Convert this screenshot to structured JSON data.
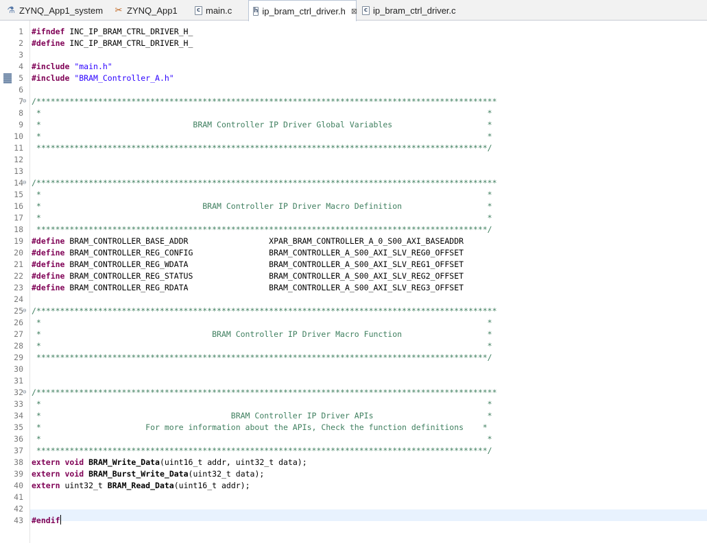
{
  "tabs": [
    {
      "label": "ZYNQ_App1_system",
      "icon": "system-project-icon",
      "glyph": "⚗",
      "active": false
    },
    {
      "label": "ZYNQ_App1",
      "icon": "application-project-icon",
      "glyph": "✂",
      "active": false
    },
    {
      "label": "main.c",
      "icon": "c-source-file-icon",
      "glyph": "c",
      "active": false
    },
    {
      "label": "ip_bram_ctrl_driver.h",
      "icon": "header-file-icon",
      "glyph": "h",
      "active": true
    },
    {
      "label": "ip_bram_ctrl_driver.c",
      "icon": "c-source-file-icon",
      "glyph": "c",
      "active": false
    }
  ],
  "close_glyph": "⊠",
  "fold_glyph": "⊖",
  "colors": {
    "keyword": "#7f0055",
    "string": "#2a00ff",
    "comment": "#3f7f5f",
    "current_line": "#e8f2fe"
  },
  "current_line": 43,
  "lines": [
    {
      "n": "1",
      "seg": [
        {
          "c": "kw",
          "t": "#ifndef"
        },
        {
          "c": "",
          "t": " INC_IP_BRAM_CTRL_DRIVER_H_"
        }
      ]
    },
    {
      "n": "2",
      "seg": [
        {
          "c": "kw",
          "t": "#define"
        },
        {
          "c": "",
          "t": " INC_IP_BRAM_CTRL_DRIVER_H_"
        }
      ]
    },
    {
      "n": "3",
      "seg": []
    },
    {
      "n": "4",
      "seg": [
        {
          "c": "kw",
          "t": "#include"
        },
        {
          "c": "",
          "t": " "
        },
        {
          "c": "str",
          "t": "\"main.h\""
        }
      ]
    },
    {
      "n": "5",
      "marker": true,
      "seg": [
        {
          "c": "kw",
          "t": "#include"
        },
        {
          "c": "",
          "t": " "
        },
        {
          "c": "str",
          "t": "\"BRAM_Controller_A.h\""
        }
      ]
    },
    {
      "n": "6",
      "seg": []
    },
    {
      "n": "7",
      "fold": true,
      "seg": [
        {
          "c": "cm",
          "t": "/*************************************************************************************************"
        }
      ]
    },
    {
      "n": "8",
      "seg": [
        {
          "c": "cm",
          "t": " *                                                                                              *"
        }
      ]
    },
    {
      "n": "9",
      "seg": [
        {
          "c": "cm",
          "t": " *                                BRAM Controller IP Driver Global Variables                    *"
        }
      ]
    },
    {
      "n": "10",
      "seg": [
        {
          "c": "cm",
          "t": " *                                                                                              *"
        }
      ]
    },
    {
      "n": "11",
      "seg": [
        {
          "c": "cm",
          "t": " ***********************************************************************************************/"
        }
      ]
    },
    {
      "n": "12",
      "seg": []
    },
    {
      "n": "13",
      "seg": []
    },
    {
      "n": "14",
      "fold": true,
      "seg": [
        {
          "c": "cm",
          "t": "/*************************************************************************************************"
        }
      ]
    },
    {
      "n": "15",
      "seg": [
        {
          "c": "cm",
          "t": " *                                                                                              *"
        }
      ]
    },
    {
      "n": "16",
      "seg": [
        {
          "c": "cm",
          "t": " *                                  BRAM Controller IP Driver Macro Definition                  *"
        }
      ]
    },
    {
      "n": "17",
      "seg": [
        {
          "c": "cm",
          "t": " *                                                                                              *"
        }
      ]
    },
    {
      "n": "18",
      "seg": [
        {
          "c": "cm",
          "t": " ***********************************************************************************************/"
        }
      ]
    },
    {
      "n": "19",
      "seg": [
        {
          "c": "kw",
          "t": "#define"
        },
        {
          "c": "",
          "t": " BRAM_CONTROLLER_BASE_ADDR                 XPAR_BRAM_CONTROLLER_A_0_S00_AXI_BASEADDR"
        }
      ]
    },
    {
      "n": "20",
      "seg": [
        {
          "c": "kw",
          "t": "#define"
        },
        {
          "c": "",
          "t": " BRAM_CONTROLLER_REG_CONFIG                BRAM_CONTROLLER_A_S00_AXI_SLV_REG0_OFFSET"
        }
      ]
    },
    {
      "n": "21",
      "seg": [
        {
          "c": "kw",
          "t": "#define"
        },
        {
          "c": "",
          "t": " BRAM_CONTROLLER_REG_WDATA                 BRAM_CONTROLLER_A_S00_AXI_SLV_REG1_OFFSET"
        }
      ]
    },
    {
      "n": "22",
      "seg": [
        {
          "c": "kw",
          "t": "#define"
        },
        {
          "c": "",
          "t": " BRAM_CONTROLLER_REG_STATUS                BRAM_CONTROLLER_A_S00_AXI_SLV_REG2_OFFSET"
        }
      ]
    },
    {
      "n": "23",
      "seg": [
        {
          "c": "kw",
          "t": "#define"
        },
        {
          "c": "",
          "t": " BRAM_CONTROLLER_REG_RDATA                 BRAM_CONTROLLER_A_S00_AXI_SLV_REG3_OFFSET"
        }
      ]
    },
    {
      "n": "24",
      "seg": []
    },
    {
      "n": "25",
      "fold": true,
      "seg": [
        {
          "c": "cm",
          "t": "/*************************************************************************************************"
        }
      ]
    },
    {
      "n": "26",
      "seg": [
        {
          "c": "cm",
          "t": " *                                                                                              *"
        }
      ]
    },
    {
      "n": "27",
      "seg": [
        {
          "c": "cm",
          "t": " *                                    BRAM Controller IP Driver Macro Function                  *"
        }
      ]
    },
    {
      "n": "28",
      "seg": [
        {
          "c": "cm",
          "t": " *                                                                                              *"
        }
      ]
    },
    {
      "n": "29",
      "seg": [
        {
          "c": "cm",
          "t": " ***********************************************************************************************/"
        }
      ]
    },
    {
      "n": "30",
      "seg": []
    },
    {
      "n": "31",
      "seg": []
    },
    {
      "n": "32",
      "fold": true,
      "seg": [
        {
          "c": "cm",
          "t": "/*************************************************************************************************"
        }
      ]
    },
    {
      "n": "33",
      "seg": [
        {
          "c": "cm",
          "t": " *                                                                                              *"
        }
      ]
    },
    {
      "n": "34",
      "seg": [
        {
          "c": "cm",
          "t": " *                                        BRAM Controller IP Driver APIs                        *"
        }
      ]
    },
    {
      "n": "35",
      "seg": [
        {
          "c": "cm",
          "t": " *                      For more information about the APIs, Check the function definitions    *"
        }
      ]
    },
    {
      "n": "36",
      "seg": [
        {
          "c": "cm",
          "t": " *                                                                                              *"
        }
      ]
    },
    {
      "n": "37",
      "seg": [
        {
          "c": "cm",
          "t": " ***********************************************************************************************/"
        }
      ]
    },
    {
      "n": "38",
      "seg": [
        {
          "c": "kw",
          "t": "extern"
        },
        {
          "c": "",
          "t": " "
        },
        {
          "c": "kw",
          "t": "void"
        },
        {
          "c": "",
          "t": " "
        },
        {
          "c": "fn",
          "t": "BRAM_Write_Data"
        },
        {
          "c": "",
          "t": "(uint16_t addr, uint32_t data);"
        }
      ]
    },
    {
      "n": "39",
      "seg": [
        {
          "c": "kw",
          "t": "extern"
        },
        {
          "c": "",
          "t": " "
        },
        {
          "c": "kw",
          "t": "void"
        },
        {
          "c": "",
          "t": " "
        },
        {
          "c": "fn",
          "t": "BRAM_Burst_Write_Data"
        },
        {
          "c": "",
          "t": "(uint32_t data);"
        }
      ]
    },
    {
      "n": "40",
      "seg": [
        {
          "c": "kw",
          "t": "extern"
        },
        {
          "c": "",
          "t": " uint32_t "
        },
        {
          "c": "fn",
          "t": "BRAM_Read_Data"
        },
        {
          "c": "",
          "t": "(uint16_t addr);"
        }
      ]
    },
    {
      "n": "41",
      "seg": []
    },
    {
      "n": "42",
      "seg": []
    },
    {
      "n": "43",
      "cursor": true,
      "seg": [
        {
          "c": "kw",
          "t": "#endif"
        }
      ]
    }
  ]
}
